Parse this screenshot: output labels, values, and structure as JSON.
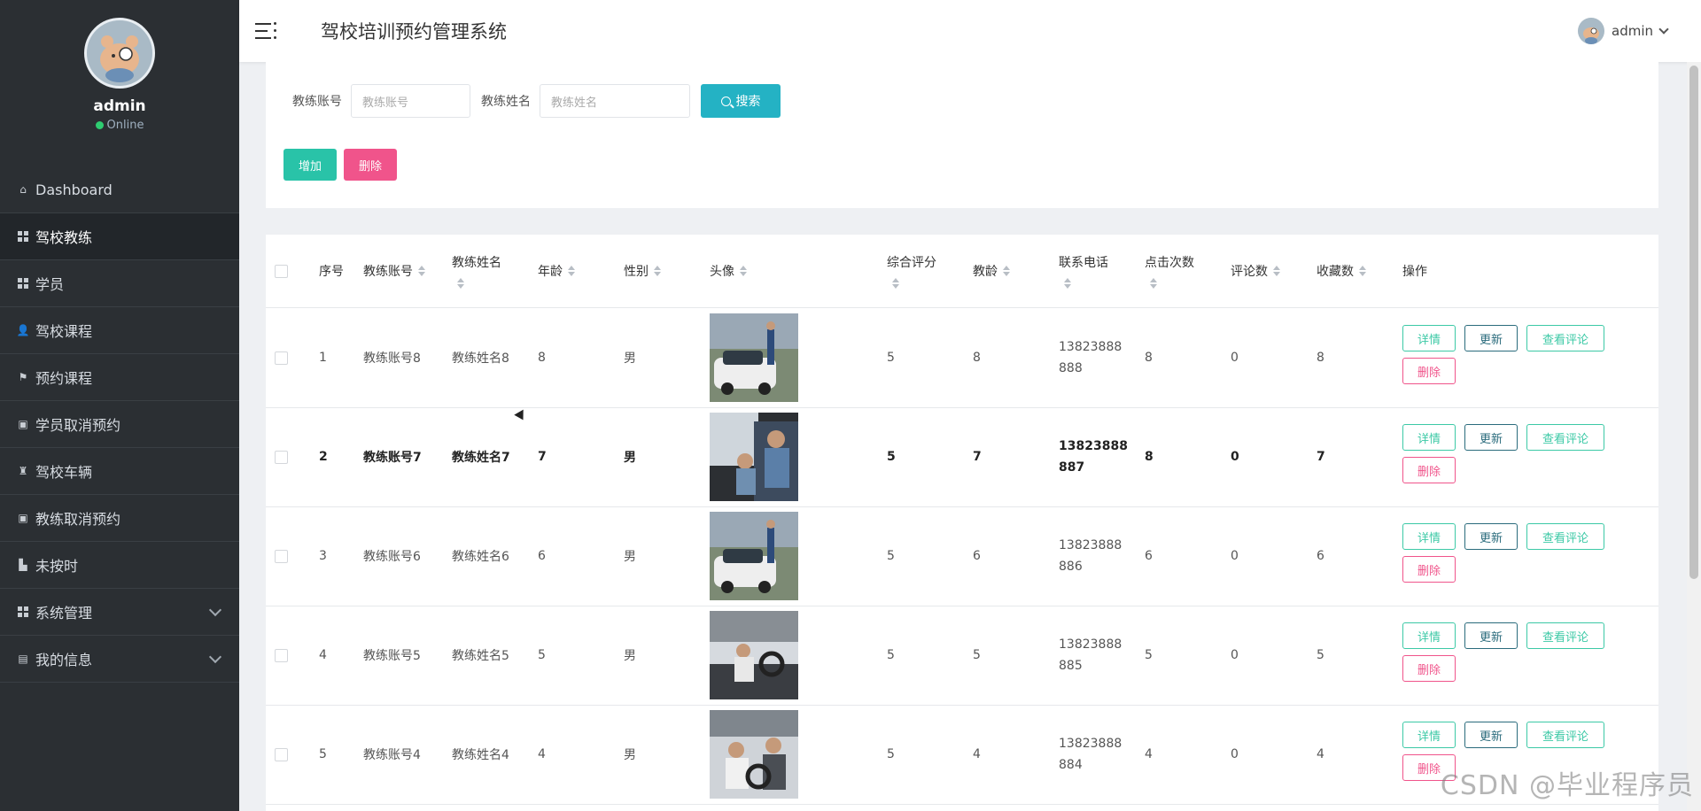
{
  "app": {
    "title": "驾校培训预约管理系统"
  },
  "user": {
    "name": "admin",
    "status": "Online"
  },
  "topbar": {
    "username": "admin"
  },
  "sidebar": {
    "items": [
      {
        "label": "Dashboard",
        "icon": "home-icon"
      },
      {
        "label": "驾校教练",
        "icon": "grid-icon",
        "active": true
      },
      {
        "label": "学员",
        "icon": "grid-icon"
      },
      {
        "label": "驾校课程",
        "icon": "user-icon"
      },
      {
        "label": "预约课程",
        "icon": "flag-icon"
      },
      {
        "label": "学员取消预约",
        "icon": "clipboard-icon"
      },
      {
        "label": "驾校车辆",
        "icon": "trophy-icon"
      },
      {
        "label": "教练取消预约",
        "icon": "clipboard-icon"
      },
      {
        "label": "未按时",
        "icon": "bar-chart-icon"
      },
      {
        "label": "系统管理",
        "icon": "grid-icon",
        "expandable": true
      },
      {
        "label": "我的信息",
        "icon": "card-icon",
        "expandable": true
      }
    ]
  },
  "search": {
    "account_label": "教练账号",
    "account_placeholder": "教练账号",
    "name_label": "教练姓名",
    "name_placeholder": "教练姓名",
    "button": "搜索"
  },
  "actions": {
    "add": "增加",
    "delete": "删除"
  },
  "table": {
    "headers": {
      "index": "序号",
      "account": "教练账号",
      "name": "教练姓名",
      "age": "年龄",
      "gender": "性别",
      "avatar": "头像",
      "rating": "综合评分",
      "teaching_years": "教龄",
      "phone": "联系电话",
      "clicks": "点击次数",
      "comments": "评论数",
      "favorites": "收藏数",
      "operations": "操作"
    },
    "row_buttons": {
      "detail": "详情",
      "update": "更新",
      "view_reviews": "查看评论",
      "delete": "删除"
    },
    "rows": [
      {
        "index": "1",
        "account": "教练账号8",
        "name": "教练姓名8",
        "age": "8",
        "gender": "男",
        "rating": "5",
        "teaching_years": "8",
        "phone": "13823888888",
        "clicks": "8",
        "comments": "0",
        "favorites": "8"
      },
      {
        "index": "2",
        "account": "教练账号7",
        "name": "教练姓名7",
        "age": "7",
        "gender": "男",
        "rating": "5",
        "teaching_years": "7",
        "phone": "13823888887",
        "clicks": "8",
        "comments": "0",
        "favorites": "7"
      },
      {
        "index": "3",
        "account": "教练账号6",
        "name": "教练姓名6",
        "age": "6",
        "gender": "男",
        "rating": "5",
        "teaching_years": "6",
        "phone": "13823888886",
        "clicks": "6",
        "comments": "0",
        "favorites": "6"
      },
      {
        "index": "4",
        "account": "教练账号5",
        "name": "教练姓名5",
        "age": "5",
        "gender": "男",
        "rating": "5",
        "teaching_years": "5",
        "phone": "13823888885",
        "clicks": "5",
        "comments": "0",
        "favorites": "5"
      },
      {
        "index": "5",
        "account": "教练账号4",
        "name": "教练姓名4",
        "age": "4",
        "gender": "男",
        "rating": "5",
        "teaching_years": "4",
        "phone": "13823888884",
        "clicks": "4",
        "comments": "0",
        "favorites": "4"
      }
    ]
  },
  "watermark": "CSDN @毕业程序员"
}
